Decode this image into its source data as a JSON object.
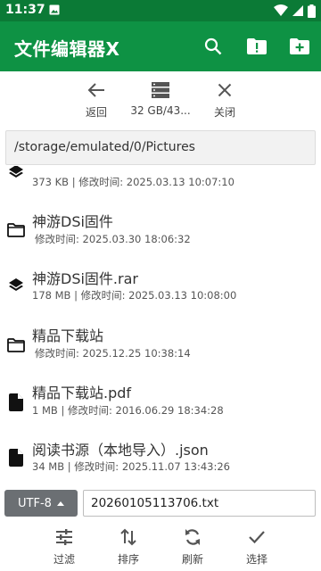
{
  "status_bar": {
    "time": "11:37"
  },
  "app_bar": {
    "title": "文件编辑器X",
    "actions": [
      "search-icon",
      "alert-folder-icon",
      "new-folder-icon"
    ]
  },
  "nav": {
    "back_label": "返回",
    "storage_label": "32 GB/43...",
    "close_label": "关闭"
  },
  "path": "/storage/emulated/0/Pictures",
  "files": [
    {
      "name": "",
      "meta": "373 KB | 修改时间: 2025.03.13 10:07:10",
      "icon": "layers-icon"
    },
    {
      "name": "神游DSi固件",
      "meta": "修改时间: 2025.03.30 18:06:32",
      "icon": "folder-icon"
    },
    {
      "name": "神游DSi固件.rar",
      "meta": "178 MB | 修改时间: 2025.03.13 10:08:00",
      "icon": "layers-icon"
    },
    {
      "name": "精品下载站",
      "meta": "修改时间: 2025.12.25 10:38:14",
      "icon": "folder-icon"
    },
    {
      "name": "精品下载站.pdf",
      "meta": "1 MB | 修改时间: 2016.06.29 18:34:28",
      "icon": "file-icon"
    },
    {
      "name": "阅读书源（本地导入）.json",
      "meta": "34 MB | 修改时间: 2025.11.07 13:43:26",
      "icon": "file-icon"
    }
  ],
  "encoding": "UTF-8",
  "filename_value": "20260105113706.txt",
  "tools": {
    "filter_label": "过滤",
    "sort_label": "排序",
    "refresh_label": "刷新",
    "select_label": "选择"
  },
  "colors": {
    "status_bar": "#0b7a36",
    "app_bar": "#0e9244",
    "encoding_button": "#6b6f73"
  }
}
